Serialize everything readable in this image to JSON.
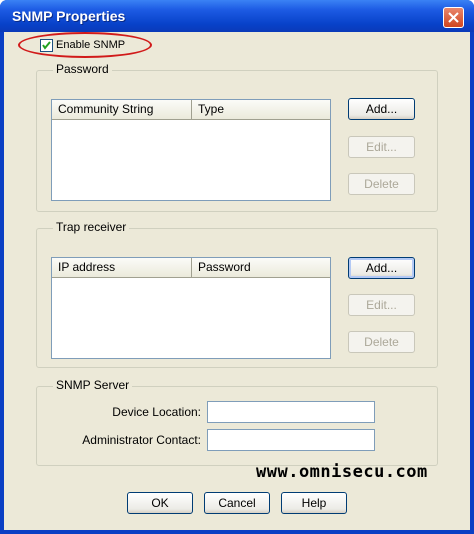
{
  "window": {
    "title": "SNMP Properties"
  },
  "enable_snmp": {
    "label": "Enable SNMP",
    "checked": true
  },
  "password_group": {
    "title": "Password",
    "columns": [
      "Community String",
      "Type"
    ],
    "buttons": {
      "add": "Add...",
      "edit": "Edit...",
      "delete": "Delete"
    }
  },
  "trap_group": {
    "title": "Trap receiver",
    "columns": [
      "IP address",
      "Password"
    ],
    "buttons": {
      "add": "Add...",
      "edit": "Edit...",
      "delete": "Delete"
    }
  },
  "server_group": {
    "title": "SNMP Server",
    "device_location_label": "Device Location:",
    "device_location_value": "",
    "admin_contact_label": "Administrator Contact:",
    "admin_contact_value": ""
  },
  "watermark": "www.omnisecu.com",
  "footer": {
    "ok": "OK",
    "cancel": "Cancel",
    "help": "Help"
  },
  "colors": {
    "titlebar": "#0842c9",
    "highlight": "#d11a1a",
    "face": "#ece9d8"
  }
}
